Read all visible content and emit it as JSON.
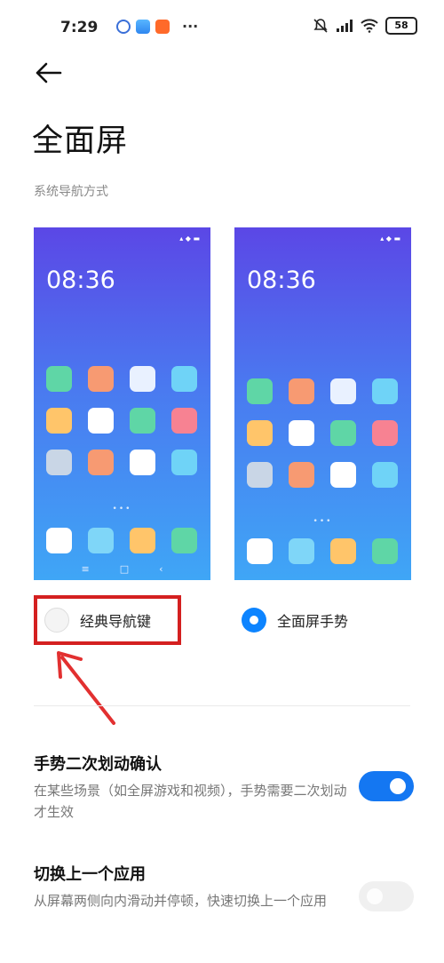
{
  "status_bar": {
    "time": "7:29",
    "dots": "···",
    "battery": "58"
  },
  "page": {
    "title": "全面屏",
    "section_label": "系统导航方式"
  },
  "previews": [
    {
      "clock": "08:36",
      "nav_buttons": [
        "≡",
        "□",
        "‹"
      ]
    },
    {
      "clock": "08:36"
    }
  ],
  "options": [
    {
      "label": "经典导航键",
      "selected": false
    },
    {
      "label": "全面屏手势",
      "selected": true
    }
  ],
  "settings": [
    {
      "title": "手势二次划动确认",
      "description": "在某些场景（如全屏游戏和视频），手势需要二次划动才生效",
      "enabled": true
    },
    {
      "title": "切换上一个应用",
      "description": "从屏幕两侧向内滑动并停顿，快速切换上一个应用",
      "enabled": false
    }
  ],
  "icons": {
    "back": "back-arrow-icon",
    "annotation": "red-arrow-annotation"
  },
  "colors": {
    "accent": "#1477f2",
    "highlight_box": "#d42020"
  }
}
